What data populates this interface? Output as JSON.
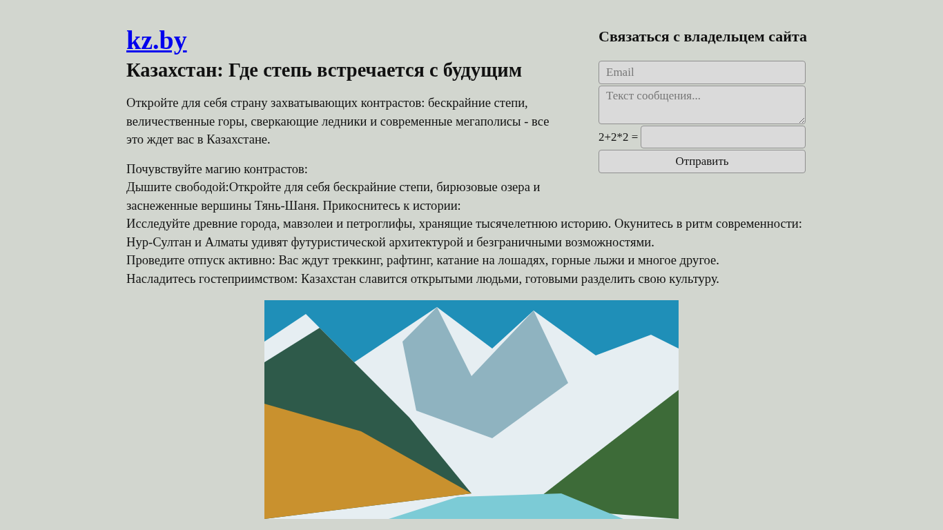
{
  "site_link": "kz.by",
  "contact_form": {
    "title": "Связаться с владельцем сайта",
    "email": {
      "placeholder": "Email"
    },
    "message": {
      "placeholder": "Текст сообщения..."
    },
    "captcha_label": "2+2*2 =",
    "submit": "Отправить"
  },
  "article": {
    "title": "Казахстан: Где степь встречается с будущим",
    "intro": "Откройте для себя страну захватывающих контрастов: бескрайние степи, величественные горы, сверкающие ледники и современные мегаполисы - все это ждет вас в Казахстане.",
    "body_lines": [
      "Почувствуйте магию контрастов:",
      "Дышите свободой:Откройте для себя бескрайние степи, бирюзовые озера и заснеженные вершины Тянь-Шаня. Прикоснитесь к истории:",
      "Исследуйте древние города, мавзолеи и петроглифы, хранящие тысячелетнюю историю. Окунитесь в ритм современности: Нур-Султан и Алматы удивят футуристической архитектурой и безграничными возможностями.",
      "Проведите отпуск активно: Вас ждут треккинг, рафтинг, катание на лошадях, горные лыжи и многое другое.",
      "Насладитесь гостеприимством: Казахстан славится открытыми людьми, готовыми разделить свою культуру."
    ]
  }
}
